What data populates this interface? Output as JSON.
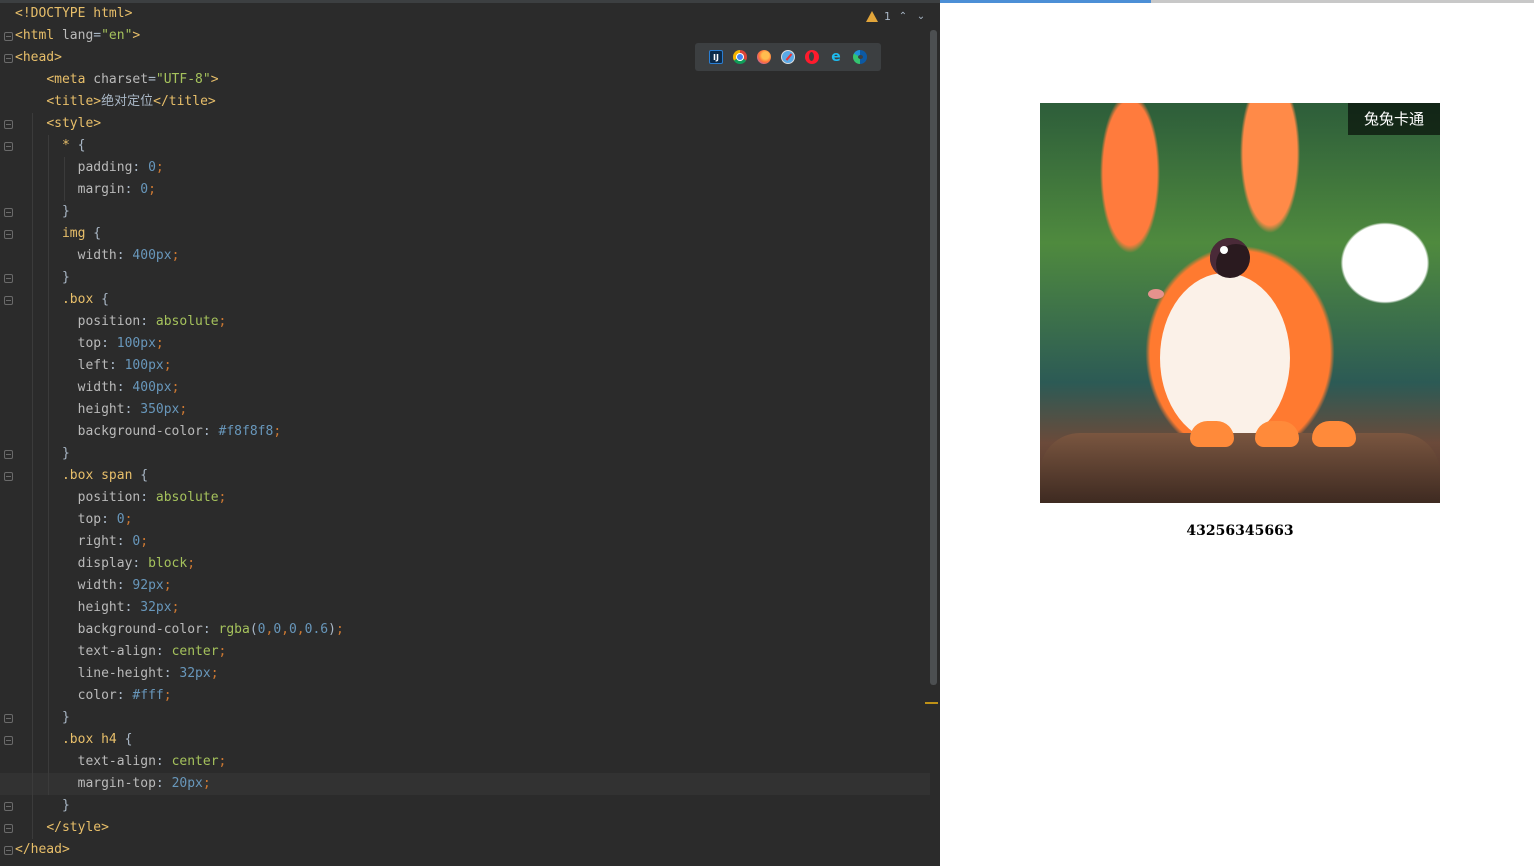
{
  "editor": {
    "lines": [
      [
        [
          "t-tag",
          "<!DOCTYPE html>"
        ]
      ],
      [
        [
          "t-tag",
          "<html "
        ],
        [
          "t-attr",
          "lang"
        ],
        [
          "t-text",
          "="
        ],
        [
          "t-str",
          "\"en\""
        ],
        [
          "t-tag",
          ">"
        ]
      ],
      [
        [
          "t-tag",
          "<head>"
        ]
      ],
      [
        [
          "t-text",
          "    "
        ],
        [
          "t-tag",
          "<meta "
        ],
        [
          "t-attr",
          "charset"
        ],
        [
          "t-text",
          "="
        ],
        [
          "t-str",
          "\"UTF-8\""
        ],
        [
          "t-tag",
          ">"
        ]
      ],
      [
        [
          "t-text",
          "    "
        ],
        [
          "t-tag",
          "<title>"
        ],
        [
          "t-text",
          "绝对定位"
        ],
        [
          "t-tag",
          "</title>"
        ]
      ],
      [
        [
          "t-text",
          "    "
        ],
        [
          "t-tag",
          "<style>"
        ]
      ],
      [
        [
          "t-text",
          "      "
        ],
        [
          "t-sel",
          "*"
        ],
        [
          "t-text",
          " {"
        ]
      ],
      [
        [
          "t-text",
          "        "
        ],
        [
          "t-prop",
          "padding"
        ],
        [
          "t-text",
          ": "
        ],
        [
          "t-num",
          "0"
        ],
        [
          "t-punc",
          ";"
        ]
      ],
      [
        [
          "t-text",
          "        "
        ],
        [
          "t-prop",
          "margin"
        ],
        [
          "t-text",
          ": "
        ],
        [
          "t-num",
          "0"
        ],
        [
          "t-punc",
          ";"
        ]
      ],
      [
        [
          "t-text",
          "      }"
        ]
      ],
      [
        [
          "t-text",
          "      "
        ],
        [
          "t-sel",
          "img"
        ],
        [
          "t-text",
          " {"
        ]
      ],
      [
        [
          "t-text",
          "        "
        ],
        [
          "t-prop",
          "width"
        ],
        [
          "t-text",
          ": "
        ],
        [
          "t-num",
          "400px"
        ],
        [
          "t-punc",
          ";"
        ]
      ],
      [
        [
          "t-text",
          "      }"
        ]
      ],
      [
        [
          "t-text",
          "      "
        ],
        [
          "t-sel",
          ".box"
        ],
        [
          "t-text",
          " {"
        ]
      ],
      [
        [
          "t-text",
          "        "
        ],
        [
          "t-prop",
          "position"
        ],
        [
          "t-text",
          ": "
        ],
        [
          "t-kw",
          "absolute"
        ],
        [
          "t-punc",
          ";"
        ]
      ],
      [
        [
          "t-text",
          "        "
        ],
        [
          "t-prop",
          "top"
        ],
        [
          "t-text",
          ": "
        ],
        [
          "t-num",
          "100px"
        ],
        [
          "t-punc",
          ";"
        ]
      ],
      [
        [
          "t-text",
          "        "
        ],
        [
          "t-prop",
          "left"
        ],
        [
          "t-text",
          ": "
        ],
        [
          "t-num",
          "100px"
        ],
        [
          "t-punc",
          ";"
        ]
      ],
      [
        [
          "t-text",
          "        "
        ],
        [
          "t-prop",
          "width"
        ],
        [
          "t-text",
          ": "
        ],
        [
          "t-num",
          "400px"
        ],
        [
          "t-punc",
          ";"
        ]
      ],
      [
        [
          "t-text",
          "        "
        ],
        [
          "t-prop",
          "height"
        ],
        [
          "t-text",
          ": "
        ],
        [
          "t-num",
          "350px"
        ],
        [
          "t-punc",
          ";"
        ]
      ],
      [
        [
          "t-text",
          "        "
        ],
        [
          "t-prop",
          "background-color"
        ],
        [
          "t-text",
          ": "
        ],
        [
          "t-num",
          "#f8f8f8"
        ],
        [
          "t-punc",
          ";"
        ]
      ],
      [
        [
          "t-text",
          "      }"
        ]
      ],
      [
        [
          "t-text",
          "      "
        ],
        [
          "t-sel",
          ".box span"
        ],
        [
          "t-text",
          " {"
        ]
      ],
      [
        [
          "t-text",
          "        "
        ],
        [
          "t-prop",
          "position"
        ],
        [
          "t-text",
          ": "
        ],
        [
          "t-kw",
          "absolute"
        ],
        [
          "t-punc",
          ";"
        ]
      ],
      [
        [
          "t-text",
          "        "
        ],
        [
          "t-prop",
          "top"
        ],
        [
          "t-text",
          ": "
        ],
        [
          "t-num",
          "0"
        ],
        [
          "t-punc",
          ";"
        ]
      ],
      [
        [
          "t-text",
          "        "
        ],
        [
          "t-prop",
          "right"
        ],
        [
          "t-text",
          ": "
        ],
        [
          "t-num",
          "0"
        ],
        [
          "t-punc",
          ";"
        ]
      ],
      [
        [
          "t-text",
          "        "
        ],
        [
          "t-prop",
          "display"
        ],
        [
          "t-text",
          ": "
        ],
        [
          "t-kw",
          "block"
        ],
        [
          "t-punc",
          ";"
        ]
      ],
      [
        [
          "t-text",
          "        "
        ],
        [
          "t-prop",
          "width"
        ],
        [
          "t-text",
          ": "
        ],
        [
          "t-num",
          "92px"
        ],
        [
          "t-punc",
          ";"
        ]
      ],
      [
        [
          "t-text",
          "        "
        ],
        [
          "t-prop",
          "height"
        ],
        [
          "t-text",
          ": "
        ],
        [
          "t-num",
          "32px"
        ],
        [
          "t-punc",
          ";"
        ]
      ],
      [
        [
          "t-text",
          "        "
        ],
        [
          "t-prop",
          "background-color"
        ],
        [
          "t-text",
          ": "
        ],
        [
          "t-kw",
          "rgba"
        ],
        [
          "t-text",
          "("
        ],
        [
          "t-num",
          "0"
        ],
        [
          "t-punc",
          ","
        ],
        [
          "t-num",
          "0"
        ],
        [
          "t-punc",
          ","
        ],
        [
          "t-num",
          "0"
        ],
        [
          "t-punc",
          ","
        ],
        [
          "t-num",
          "0.6"
        ],
        [
          "t-text",
          ")"
        ],
        [
          "t-punc",
          ";"
        ]
      ],
      [
        [
          "t-text",
          "        "
        ],
        [
          "t-prop",
          "text-align"
        ],
        [
          "t-text",
          ": "
        ],
        [
          "t-kw",
          "center"
        ],
        [
          "t-punc",
          ";"
        ]
      ],
      [
        [
          "t-text",
          "        "
        ],
        [
          "t-prop",
          "line-height"
        ],
        [
          "t-text",
          ": "
        ],
        [
          "t-num",
          "32px"
        ],
        [
          "t-punc",
          ";"
        ]
      ],
      [
        [
          "t-text",
          "        "
        ],
        [
          "t-prop",
          "color"
        ],
        [
          "t-text",
          ": "
        ],
        [
          "t-num",
          "#fff"
        ],
        [
          "t-punc",
          ";"
        ]
      ],
      [
        [
          "t-text",
          "      }"
        ]
      ],
      [
        [
          "t-text",
          "      "
        ],
        [
          "t-sel",
          ".box h4"
        ],
        [
          "t-text",
          " {"
        ]
      ],
      [
        [
          "t-text",
          "        "
        ],
        [
          "t-prop",
          "text-align"
        ],
        [
          "t-text",
          ": "
        ],
        [
          "t-kw",
          "center"
        ],
        [
          "t-punc",
          ";"
        ]
      ],
      [
        [
          "t-text",
          "        "
        ],
        [
          "t-prop",
          "margin-top"
        ],
        [
          "t-text",
          ": "
        ],
        [
          "t-num",
          "20px"
        ],
        [
          "t-punc",
          ";"
        ]
      ],
      [
        [
          "t-text",
          "      }"
        ]
      ],
      [
        [
          "t-text",
          "    "
        ],
        [
          "t-tag",
          "</style>"
        ]
      ],
      [
        [
          "t-tag",
          "</head>"
        ]
      ]
    ],
    "current_line": 35,
    "inspection": {
      "warning_count": "1"
    },
    "browser_icons": [
      "intellij-icon",
      "chrome-icon",
      "firefox-icon",
      "safari-icon",
      "opera-icon",
      "ie-icon",
      "edge-icon"
    ]
  },
  "preview": {
    "badge_text": "兔兔卡通",
    "caption": "43256345663",
    "image_name": "cartoon-rabbit-image"
  }
}
